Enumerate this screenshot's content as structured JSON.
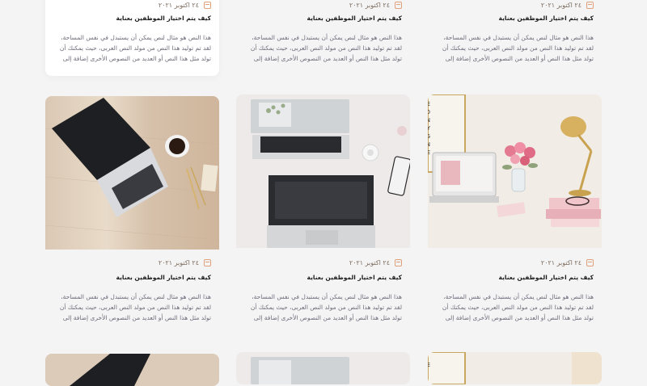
{
  "common": {
    "date": "٢٤ اكتوبر ٢٠٢١",
    "title": "كيف يتم اختيار الموظفين بعناية",
    "excerpt": "هذا النص هو مثال لنص يمكن أن يستبدل في نفس المساحة، لقد تم توليد هذا النص من مولد النص العربى، حيث يمكنك أن تولد مثل هذا النص أو العديد من النصوص الأخرى إضافة إلى"
  },
  "cards": [
    {
      "id": "top-left",
      "image": "none"
    },
    {
      "id": "top-middle",
      "image": "none"
    },
    {
      "id": "top-right",
      "image": "none"
    },
    {
      "id": "mid-left",
      "image": "laptop-on-wood-desk"
    },
    {
      "id": "mid-middle",
      "image": "two-laptops-white-desk"
    },
    {
      "id": "mid-right",
      "image": "laptop-with-flowers-and-lamp"
    },
    {
      "id": "bottom-left",
      "image": "laptop-on-wood-desk"
    },
    {
      "id": "bottom-middle",
      "image": "two-laptops-white-desk"
    },
    {
      "id": "bottom-right",
      "image": "laptop-with-flowers-and-lamp"
    }
  ],
  "colors": {
    "accent_calendar": "#e0a07a",
    "title": "#1b1b1b",
    "excerpt": "#6c6c7a",
    "background": "#f4f4f5"
  }
}
